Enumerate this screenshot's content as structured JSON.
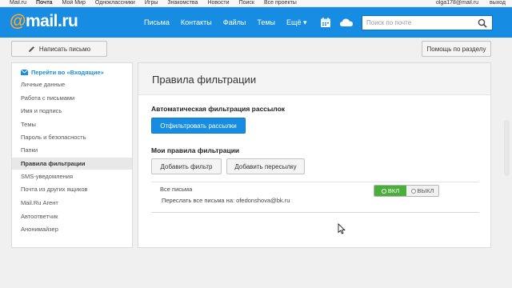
{
  "portal": {
    "links": [
      "Mail.ru",
      "Почта",
      "Мой Мир",
      "Одноклассники",
      "Игры",
      "Знакомства",
      "Новости",
      "Поиск",
      "Все проекты"
    ],
    "active_index": 1,
    "user": "olga178@mail.ru",
    "logout": "выход"
  },
  "header": {
    "logo_at": "@",
    "logo_text": "mail.ru",
    "nav": [
      "Письма",
      "Контакты",
      "Файлы",
      "Темы",
      "Ещё"
    ],
    "search_placeholder": "Поиск по почте",
    "colors": {
      "header_bg": "#168de2",
      "accent": "#ffa930"
    }
  },
  "toolbar": {
    "compose_label": "Написать письмо",
    "help_label": "Помощь по разделу"
  },
  "sidebar": {
    "back_label": "Перейти во «Входящие»",
    "items": [
      "Личные данные",
      "Работа с письмами",
      "Имя и подпись",
      "Темы",
      "Пароль и безопасность",
      "Папки",
      "Правила фильтрации",
      "SMS-уведомления",
      "Почта из других ящиков",
      "Mail.Ru Агент",
      "Автоответчик",
      "Анонимайзер"
    ],
    "active_item": "Правила фильтрации"
  },
  "main": {
    "page_title": "Правила фильтрации",
    "auto_section_title": "Автоматическая фильтрация рассылок",
    "auto_button": "Отфильтровать рассылки",
    "my_rules_title": "Мои правила фильтрации",
    "add_filter_button": "Добавить фильтр",
    "add_forward_button": "Добавить пересылку",
    "rule": {
      "name": "Все письма",
      "action": "Переслать все письма на: ofedonshova@bk.ru",
      "on_label": "ВКЛ",
      "off_label": "ВЫКЛ",
      "state": "on"
    }
  }
}
